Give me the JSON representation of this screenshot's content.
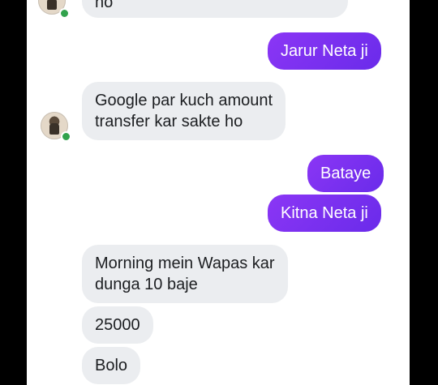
{
  "messages": {
    "m0": "ho",
    "m1": "Jarur Neta ji",
    "m2_line1": "Google par kuch amount",
    "m2_line2": "transfer kar sakte ho",
    "m3": "Bataye",
    "m4": "Kitna Neta ji",
    "m5_line1": "Morning mein Wapas kar",
    "m5_line2": "dunga 10 baje",
    "m6": "25000",
    "m7": "Bolo"
  },
  "colors": {
    "outgoing_bubble": "#7b2ff2",
    "incoming_bubble": "#ebedf0",
    "online_dot": "#31a24c",
    "frame": "#000000"
  },
  "icons": {
    "avatar": "contact-avatar",
    "online": "online-status-dot"
  }
}
